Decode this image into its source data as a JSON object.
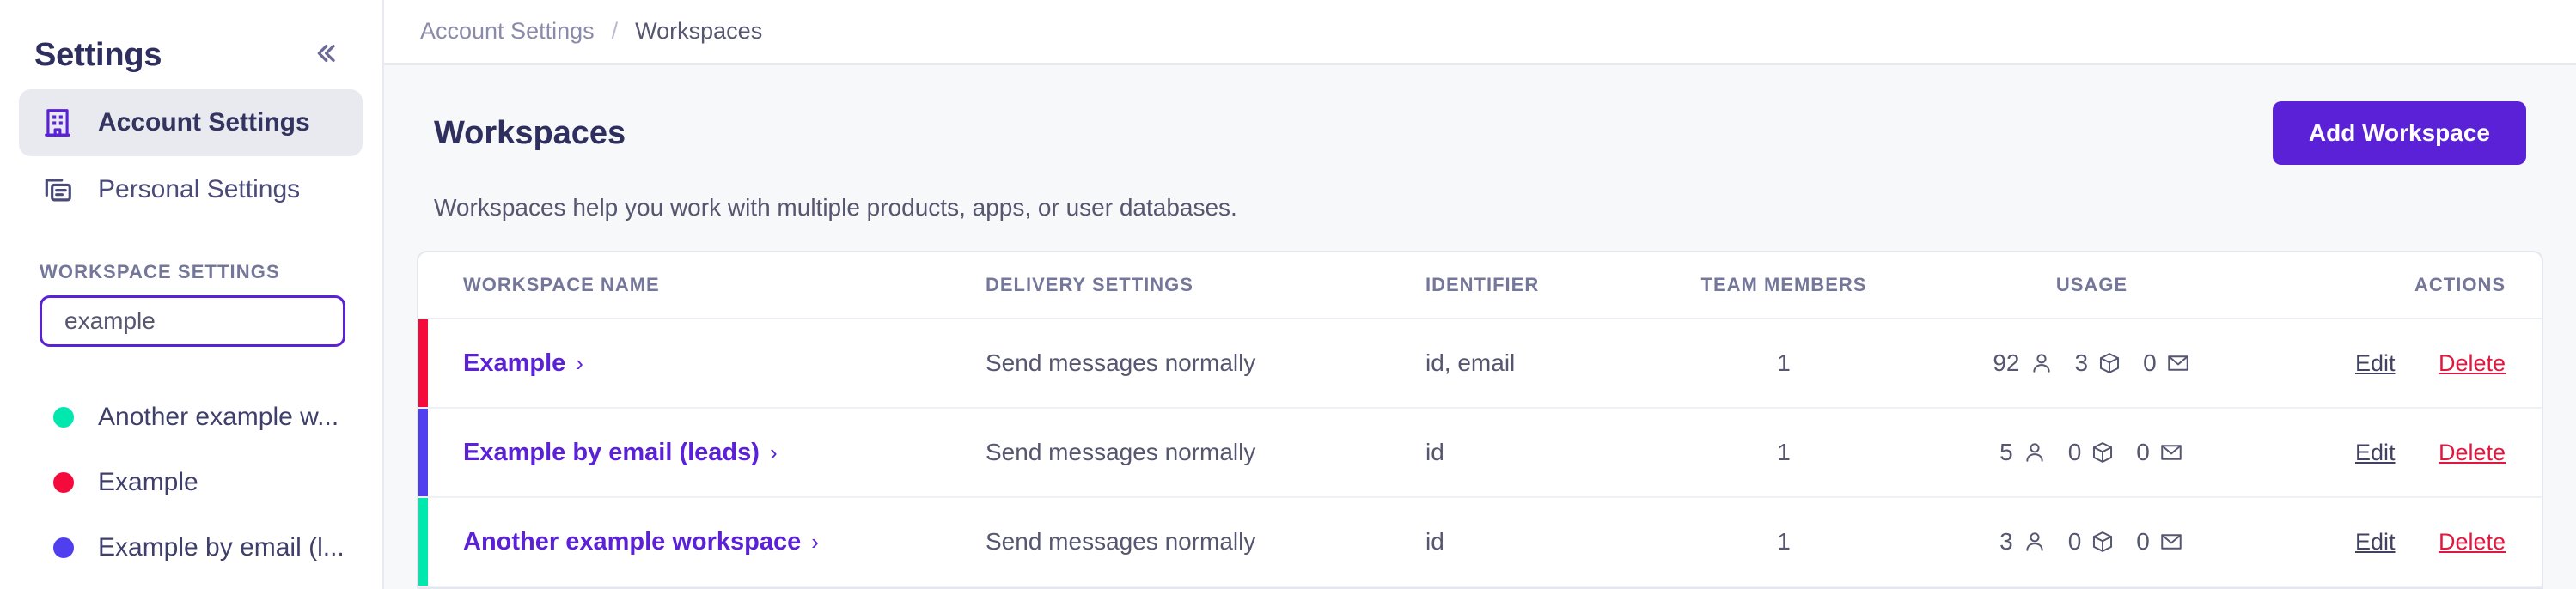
{
  "sidebar": {
    "title": "Settings",
    "collapse_icon": "chevron-double-left-icon",
    "nav": [
      {
        "label": "Account Settings",
        "icon": "building-icon",
        "active": true
      },
      {
        "label": "Personal Settings",
        "icon": "cards-copy-icon",
        "active": false
      }
    ],
    "section_label": "WORKSPACE SETTINGS",
    "search": {
      "value": "example",
      "placeholder": "Search workspaces"
    },
    "workspaces": [
      {
        "name": "Another example w...",
        "color": "#00e8ad"
      },
      {
        "name": "Example",
        "color": "#f50a3c"
      },
      {
        "name": "Example by email (l...",
        "color": "#4f3fef"
      }
    ]
  },
  "breadcrumb": {
    "items": [
      "Account Settings",
      "Workspaces"
    ],
    "separator": "/"
  },
  "page": {
    "title": "Workspaces",
    "description": "Workspaces help you work with multiple products, apps, or user databases.",
    "add_button": "Add Workspace"
  },
  "table": {
    "columns": [
      "WORKSPACE NAME",
      "DELIVERY SETTINGS",
      "IDENTIFIER",
      "TEAM MEMBERS",
      "USAGE",
      "ACTIONS"
    ],
    "actions": {
      "edit": "Edit",
      "delete": "Delete"
    },
    "usage_icons": [
      "person-icon",
      "cube-icon",
      "envelope-icon"
    ],
    "rows": [
      {
        "accent_color": "#f50a3c",
        "name": "Example",
        "delivery": "Send messages normally",
        "identifier": "id, email",
        "team_members": "1",
        "usage": {
          "people": "92",
          "objects": "3",
          "emails": "0"
        }
      },
      {
        "accent_color": "#4f3fef",
        "name": "Example by email (leads)",
        "delivery": "Send messages normally",
        "identifier": "id",
        "team_members": "1",
        "usage": {
          "people": "5",
          "objects": "0",
          "emails": "0"
        }
      },
      {
        "accent_color": "#00e8ad",
        "name": "Another example workspace",
        "delivery": "Send messages normally",
        "identifier": "id",
        "team_members": "1",
        "usage": {
          "people": "3",
          "objects": "0",
          "emails": "0"
        }
      }
    ]
  },
  "colors": {
    "brand_purple": "#5b21d6",
    "delete_red": "#e0183f",
    "text_dark": "#2e2f5e",
    "text_muted": "#75779a"
  }
}
